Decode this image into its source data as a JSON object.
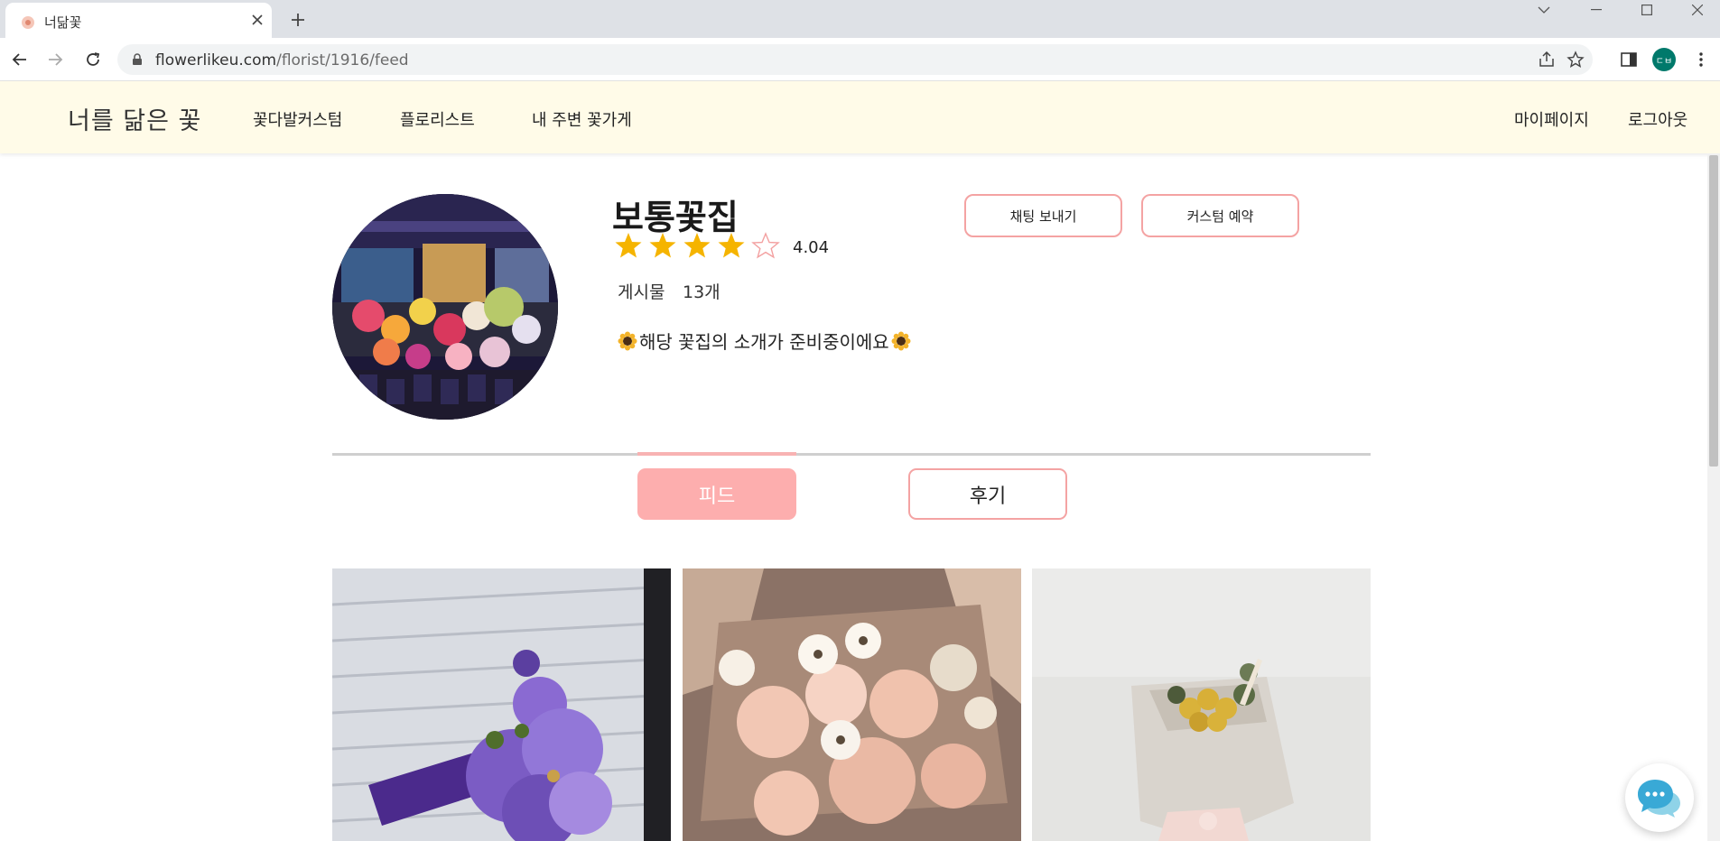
{
  "browser": {
    "tab_title": "너닮꽃",
    "url_host": "flowerlikeu.com",
    "url_path": "/florist/1916/feed",
    "profile_initials": "ㄷㅂ"
  },
  "header": {
    "brand": "너를 닮은 꽃",
    "nav": [
      "꽃다발커스텀",
      "플로리스트",
      "내 주변 꽃가게"
    ],
    "right_nav": [
      "마이페이지",
      "로그아웃"
    ]
  },
  "shop": {
    "name": "보통꽃집",
    "rating": "4.04",
    "rating_value": 4.04,
    "stars_filled": 4,
    "stars_total": 5,
    "posts_label": "게시물",
    "posts_count": "13개",
    "intro": "해당 꽃집의 소개가 준비중이에요",
    "buttons": {
      "chat": "채팅 보내기",
      "custom": "커스텀 예약"
    }
  },
  "tabs": {
    "feed": "피드",
    "review": "후기",
    "active": "feed"
  },
  "colors": {
    "header_bg": "#fffbe8",
    "accent_pink": "#fdaeae",
    "border_pink": "#f4a3a3",
    "star_gold": "#f5b400"
  },
  "icons": {
    "chat_fab": "chat-bubbles-icon",
    "sunflower": "sunflower-icon"
  }
}
